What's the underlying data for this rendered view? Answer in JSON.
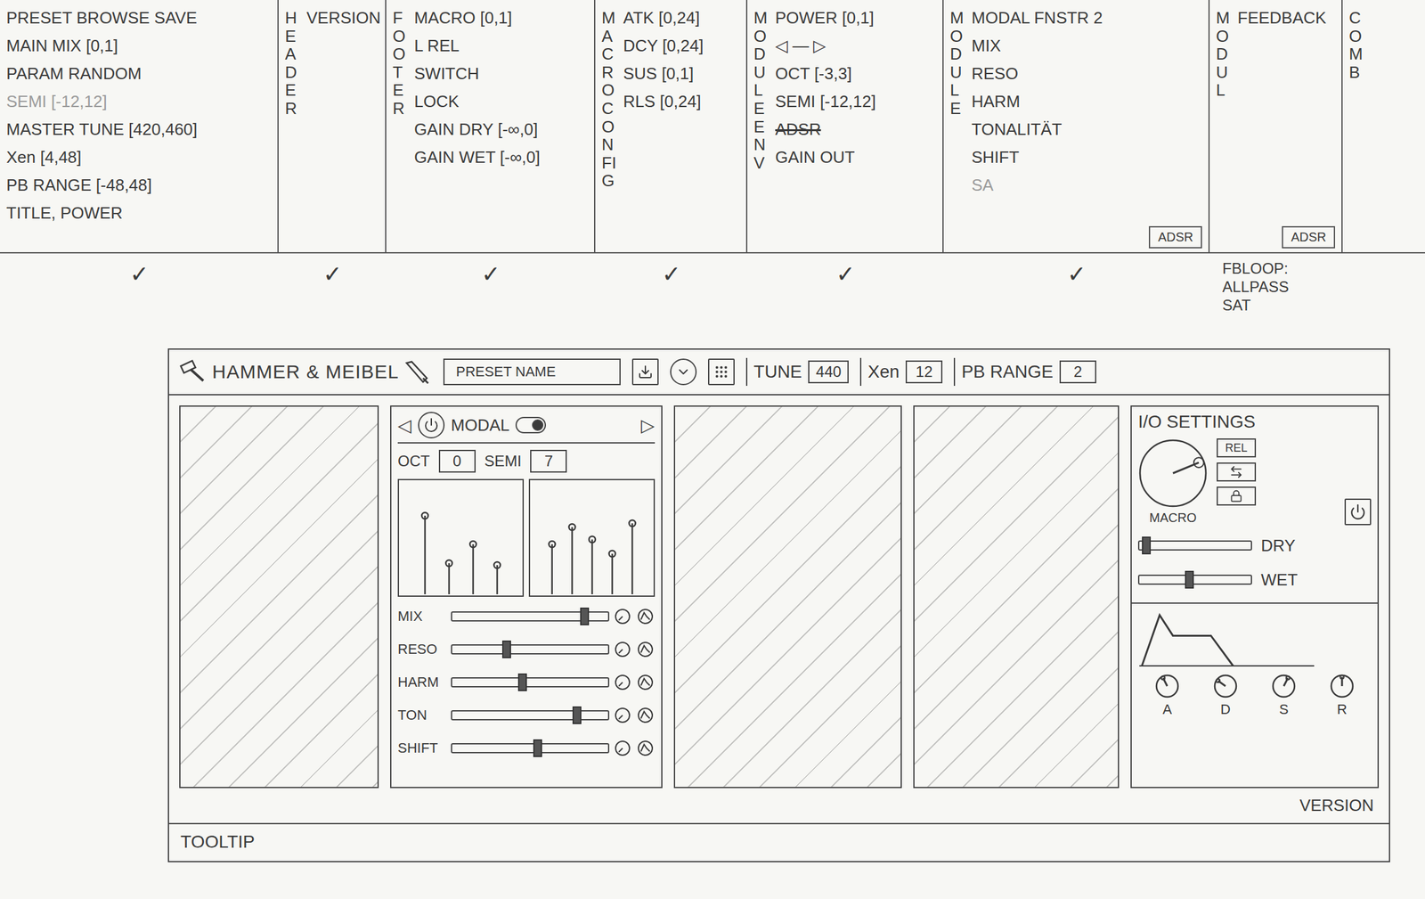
{
  "notes": {
    "columns": [
      {
        "vertical": "",
        "checked": true,
        "items": [
          {
            "text": "PRESET BROWSE SAVE",
            "faded": false,
            "struck": false
          },
          {
            "text": "MAIN MIX [0,1]",
            "faded": false,
            "struck": false
          },
          {
            "text": "PARAM RANDOM",
            "faded": false,
            "struck": false
          },
          {
            "text": "SEMI [-12,12]",
            "faded": true,
            "struck": false
          },
          {
            "text": "MASTER TUNE [420,460]",
            "faded": false,
            "struck": false
          },
          {
            "text": "Xen [4,48]",
            "faded": false,
            "struck": false
          },
          {
            "text": "PB RANGE [-48,48]",
            "faded": false,
            "struck": false
          },
          {
            "text": "TITLE, POWER",
            "faded": false,
            "struck": false
          }
        ]
      },
      {
        "vertical": "HEADER",
        "checked": true,
        "items": [
          {
            "text": "VERSION",
            "faded": false,
            "struck": false
          }
        ]
      },
      {
        "vertical": "FOOTER",
        "checked": true,
        "items": [
          {
            "text": "MACRO [0,1]",
            "faded": false,
            "struck": false
          },
          {
            "text": "L REL",
            "faded": false,
            "struck": false
          },
          {
            "text": "SWITCH",
            "faded": false,
            "struck": false
          },
          {
            "text": "LOCK",
            "faded": false,
            "struck": false
          },
          {
            "text": "GAIN DRY [-∞,0]",
            "faded": false,
            "struck": false
          },
          {
            "text": "GAIN WET [-∞,0]",
            "faded": false,
            "struck": false
          }
        ]
      },
      {
        "vertical": "MACRO CONFIG",
        "checked": true,
        "items": [
          {
            "text": "ATK [0,24]",
            "faded": false,
            "struck": false
          },
          {
            "text": "DCY [0,24]",
            "faded": false,
            "struck": false
          },
          {
            "text": "SUS [0,1]",
            "faded": false,
            "struck": false
          },
          {
            "text": "RLS [0,24]",
            "faded": false,
            "struck": false
          }
        ]
      },
      {
        "vertical": "MODULE ENV",
        "checked": true,
        "items": [
          {
            "text": "POWER [0,1]",
            "faded": false,
            "struck": false
          },
          {
            "text": "◁ — ▷",
            "faded": false,
            "struck": false
          },
          {
            "text": "OCT [-3,3]",
            "faded": false,
            "struck": false
          },
          {
            "text": "SEMI [-12,12]",
            "faded": false,
            "struck": false
          },
          {
            "text": "ADSR",
            "faded": false,
            "struck": true
          },
          {
            "text": "GAIN OUT",
            "faded": false,
            "struck": false
          }
        ]
      },
      {
        "vertical": "MODULE",
        "checked": true,
        "box": "ADSR",
        "items": [
          {
            "text": "MODAL FNSTR 2",
            "faded": false,
            "struck": false
          },
          {
            "text": "MIX",
            "faded": false,
            "struck": false
          },
          {
            "text": "RESO",
            "faded": false,
            "struck": false
          },
          {
            "text": "HARM",
            "faded": false,
            "struck": false
          },
          {
            "text": "TONALITÄT",
            "faded": false,
            "struck": false
          },
          {
            "text": "SHIFT",
            "faded": false,
            "struck": false
          },
          {
            "text": "SA",
            "faded": true,
            "struck": false
          }
        ]
      },
      {
        "vertical": "MODUL",
        "checked": false,
        "box": "ADSR",
        "items": [
          {
            "text": "FEEDBACK",
            "faded": false,
            "struck": false
          }
        ]
      },
      {
        "vertical": "COMB",
        "checked": false,
        "items": []
      }
    ],
    "check_mark": "✓",
    "footnote": [
      "FBLOOP:",
      "ALLPASS",
      "SAT"
    ]
  },
  "mockup": {
    "header": {
      "logo": "HAMMER & MEIBEL",
      "preset": "PRESET NAME",
      "fields": [
        {
          "label": "TUNE",
          "value": "440"
        },
        {
          "label": "Xen",
          "value": "12"
        },
        {
          "label": "PB RANGE",
          "value": "2"
        }
      ]
    },
    "slots": [
      {
        "kind": "empty"
      },
      {
        "kind": "modal",
        "title": "MODAL",
        "prev": "◁",
        "next": "▷",
        "on": true,
        "oct": {
          "label": "OCT",
          "value": "0"
        },
        "semi": {
          "label": "SEMI",
          "value": "7"
        },
        "spectra": [
          [
            0.8,
            0.3,
            0.5,
            0.28
          ],
          [
            0.5,
            0.68,
            0.55,
            0.4,
            0.72
          ]
        ],
        "sliders": [
          {
            "label": "MIX",
            "level": 0.85
          },
          {
            "label": "RESO",
            "level": 0.35
          },
          {
            "label": "HARM",
            "level": 0.45
          },
          {
            "label": "TON",
            "level": 0.8
          },
          {
            "label": "SHIFT",
            "level": 0.55
          }
        ]
      },
      {
        "kind": "empty"
      },
      {
        "kind": "empty"
      }
    ],
    "io": {
      "title": "I/O SETTINGS",
      "macro": {
        "label": "MACRO",
        "level": 0.75
      },
      "buttons": [
        {
          "kind": "text",
          "label": "REL"
        },
        {
          "kind": "switch"
        },
        {
          "kind": "lock"
        }
      ],
      "gains": [
        {
          "label": "DRY",
          "level": 0.06
        },
        {
          "label": "WET",
          "level": 0.45
        }
      ],
      "knobs": [
        {
          "label": "A",
          "level": 0.4
        },
        {
          "label": "D",
          "level": 0.3
        },
        {
          "label": "S",
          "level": 0.6
        },
        {
          "label": "R",
          "level": 0.5
        }
      ]
    },
    "version": "VERSION",
    "tooltip": "TOOLTIP"
  }
}
